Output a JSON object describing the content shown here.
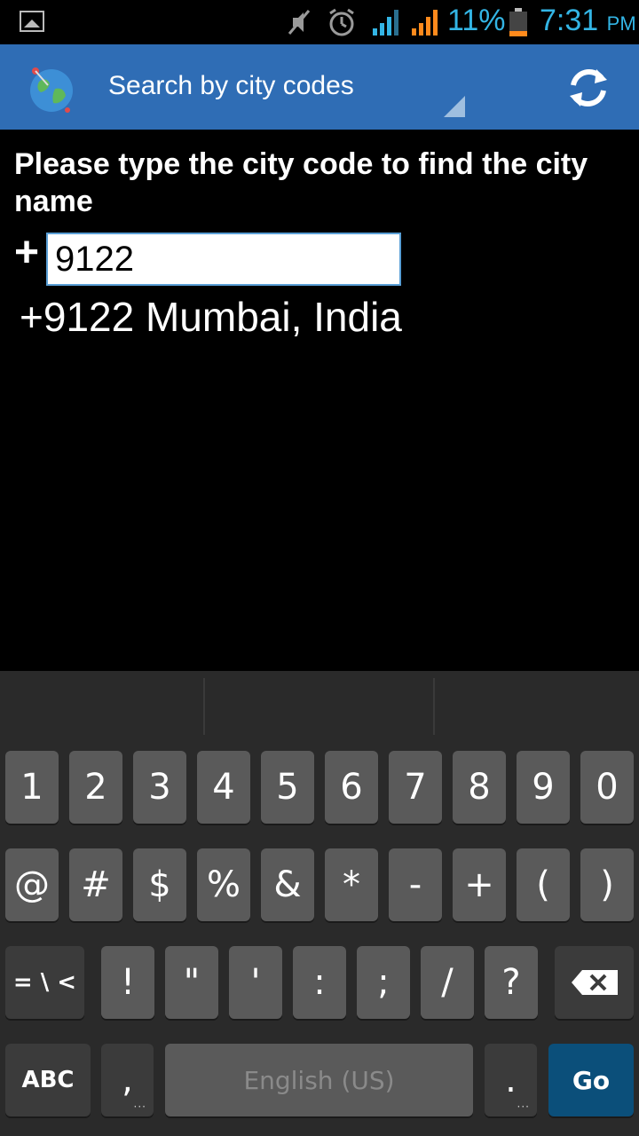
{
  "status_bar": {
    "battery": "11%",
    "time": "7:31",
    "ampm": "PM",
    "accent_color": "#33b5e5",
    "icons": [
      "image-icon",
      "mute-icon",
      "alarm-icon",
      "signal-icon",
      "signal-icon",
      "battery-icon"
    ]
  },
  "action_bar": {
    "title": "Search by city codes",
    "bg_color": "#2f6db5",
    "icons": [
      "globe-icon",
      "refresh-icon"
    ]
  },
  "main": {
    "prompt": "Please type the city code to find the city name",
    "plus": "+",
    "input_value": "9122",
    "result": "+9122 Mumbai, India"
  },
  "keyboard": {
    "row1": [
      "1",
      "2",
      "3",
      "4",
      "5",
      "6",
      "7",
      "8",
      "9",
      "0"
    ],
    "row2": [
      "@",
      "#",
      "$",
      "%",
      "&",
      "*",
      "-",
      "+",
      "(",
      ")"
    ],
    "row3_left": "= \\ <",
    "row3": [
      "!",
      "\"",
      "'",
      ":",
      ";",
      "/",
      "?"
    ],
    "abc": "ABC",
    "comma": ",",
    "space": "English (US)",
    "period": ".",
    "go": "Go"
  }
}
